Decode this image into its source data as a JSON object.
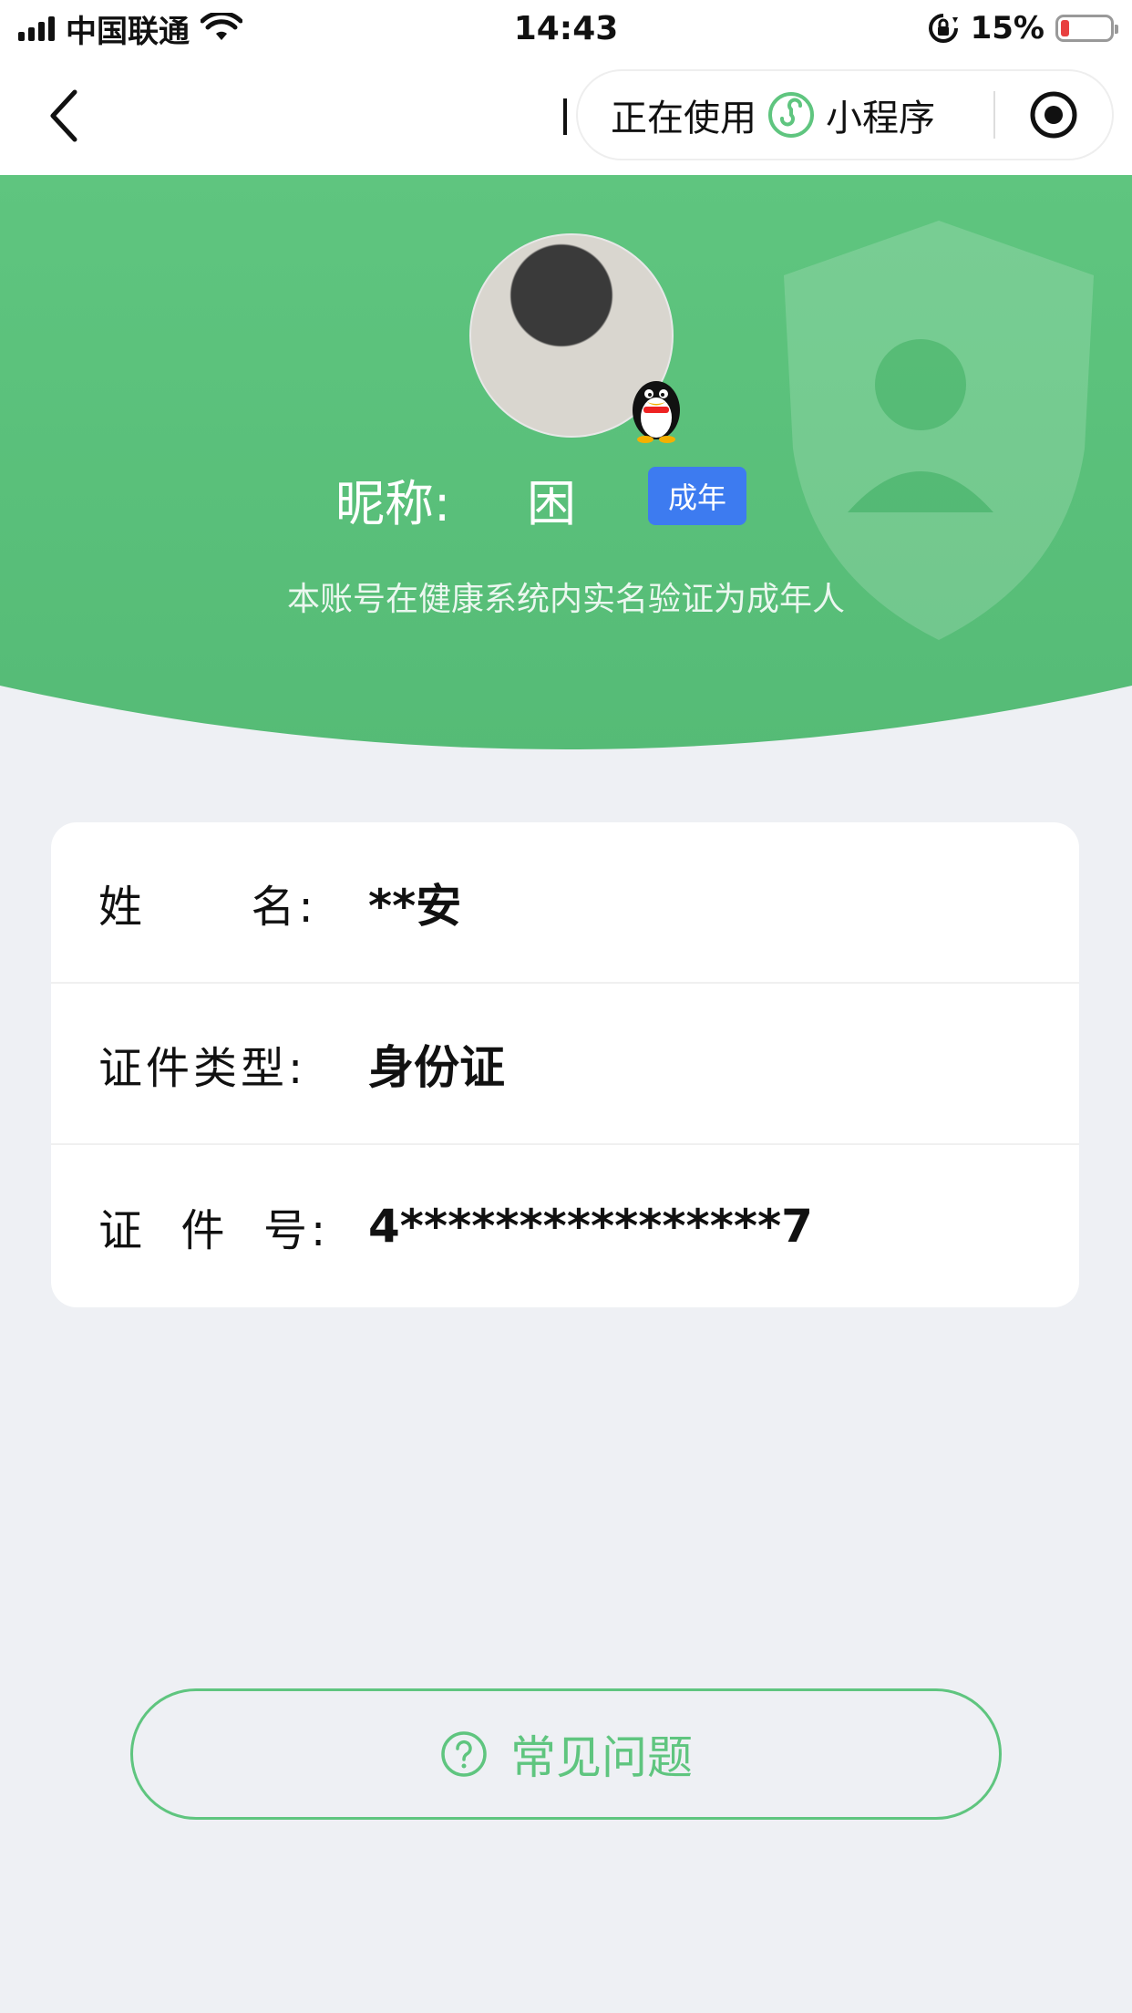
{
  "status_bar": {
    "carrier": "中国联通",
    "time": "14:43",
    "battery": "15%"
  },
  "nav": {
    "capsule_label_1": "正在使用",
    "capsule_label_2": "小程序"
  },
  "profile": {
    "nickname_label": "昵称:",
    "nickname": "困",
    "age_badge": "成年",
    "verify_text": "本账号在健康系统内实名验证为成年人"
  },
  "info": {
    "rows": [
      {
        "label": "姓      名:",
        "value": "**安"
      },
      {
        "label": "证件类型:",
        "value": "身份证"
      },
      {
        "label": "证  件  号:",
        "value": "4****************7"
      }
    ]
  },
  "faq": {
    "label": "常见问题"
  },
  "colors": {
    "brand_green": "#5fc57f",
    "badge_blue": "#3d7bf0",
    "page_bg": "#eef0f4"
  },
  "icons": [
    "signal-icon",
    "wifi-icon",
    "rotation-lock-icon",
    "battery-icon",
    "back-arrow-icon",
    "mini-program-icon",
    "record-icon",
    "shield-icon",
    "penguin-icon",
    "question-icon"
  ]
}
